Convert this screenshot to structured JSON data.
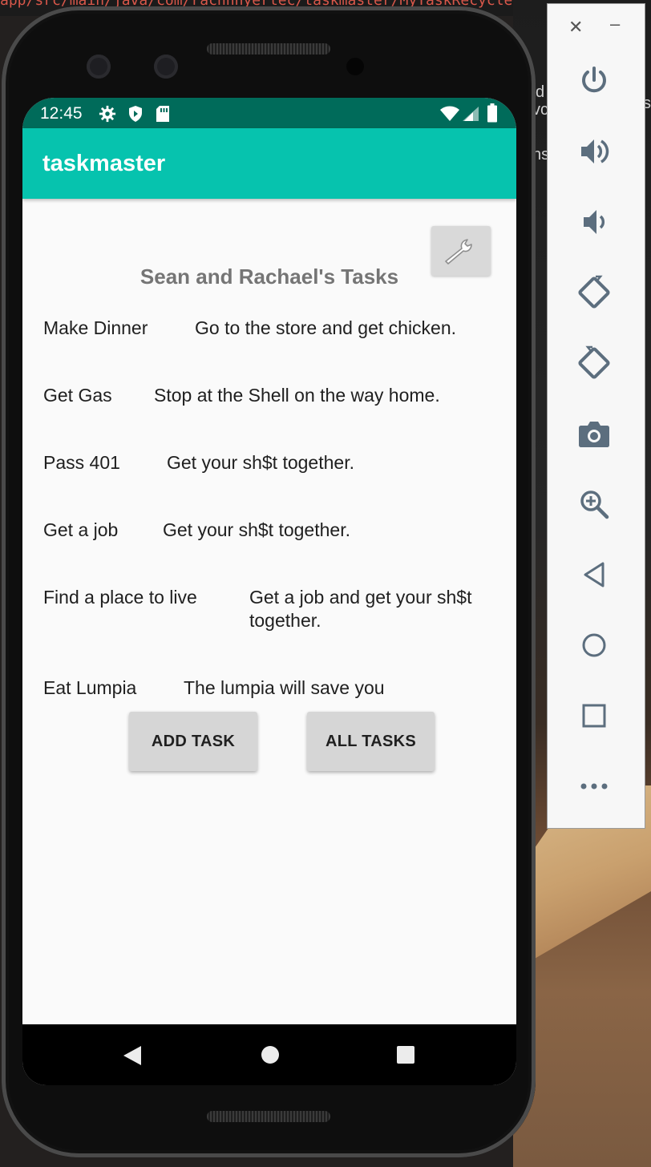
{
  "desktop": {
    "code_text": "app/src/main/java/com/rachnhyertec/taskmaster/MyTaskRecycler/",
    "side_fragments": [
      "d",
      "vc",
      "ns",
      "s"
    ]
  },
  "status_bar": {
    "time": "12:45",
    "icons": [
      "gear-icon",
      "shield-icon",
      "sd-card-icon",
      "wifi-icon",
      "signal-icon",
      "battery-icon"
    ]
  },
  "app_bar": {
    "title": "taskmaster"
  },
  "main": {
    "heading": "Sean and Rachael's Tasks",
    "settings_icon": "wrench-icon",
    "tasks": [
      {
        "title": "Make Dinner",
        "body": "Go to the store and get chicken."
      },
      {
        "title": "Get Gas",
        "body": "Stop at the Shell on the way home."
      },
      {
        "title": "Pass 401",
        "body": "Get your sh$t together."
      },
      {
        "title": "Get a job",
        "body": "Get your sh$t together."
      },
      {
        "title": "Find a place to live",
        "body": "Get a job and get your sh$t",
        "body2": "together."
      },
      {
        "title": "Eat Lumpia",
        "body": "The lumpia will save you"
      }
    ],
    "add_task_label": "ADD TASK",
    "all_tasks_label": "ALL TASKS"
  },
  "nav_bar": {
    "icons": [
      "back-icon",
      "home-icon",
      "recents-icon"
    ]
  },
  "emulator_panel": {
    "close": "✕",
    "minimize": "–",
    "tools": [
      "power-icon",
      "volume-up-icon",
      "volume-down-icon",
      "rotate-left-icon",
      "rotate-right-icon",
      "camera-icon",
      "zoom-icon",
      "back-icon",
      "home-icon",
      "overview-icon",
      "more-icon"
    ]
  },
  "colors": {
    "status_bar": "#006b5a",
    "app_bar": "#06c3ae",
    "heading": "#757575",
    "button": "#d6d6d6"
  }
}
